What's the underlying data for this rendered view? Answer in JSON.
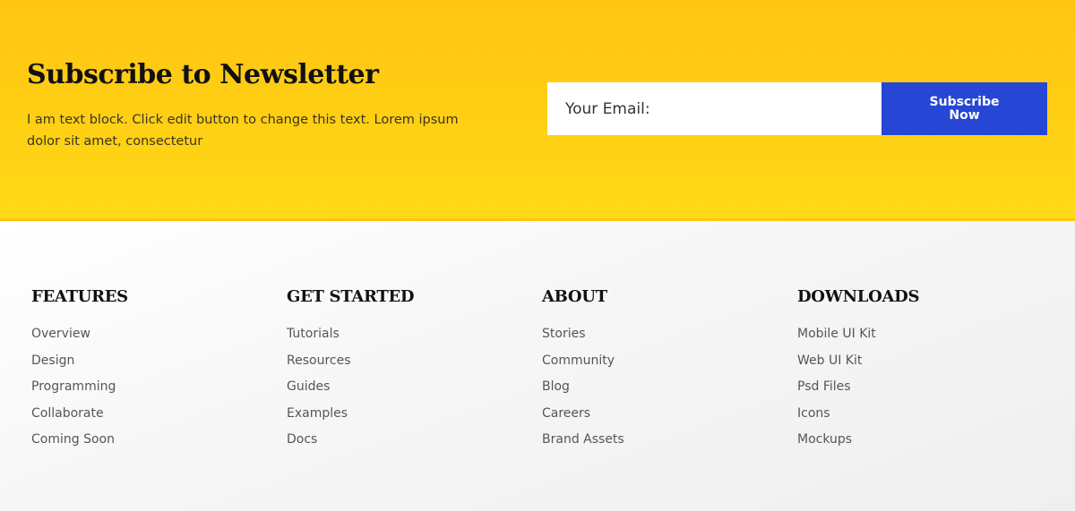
{
  "newsletter": {
    "title": "Subscribe to Newsletter",
    "text": "I am text block. Click edit button to change this text. Lorem ipsum dolor sit amet, consectetur",
    "email_placeholder": "Your Email:",
    "button_label": "Subscribe Now"
  },
  "footer": {
    "columns": [
      {
        "title": "FEATURES",
        "links": [
          "Overview",
          "Design",
          "Programming",
          "Collaborate",
          "Coming Soon"
        ]
      },
      {
        "title": "GET STARTED",
        "links": [
          "Tutorials",
          "Resources",
          "Guides",
          "Examples",
          "Docs"
        ]
      },
      {
        "title": "ABOUT",
        "links": [
          "Stories",
          "Community",
          "Blog",
          "Careers",
          "Brand Assets"
        ]
      },
      {
        "title": "DOWNLOADS",
        "links": [
          "Mobile UI Kit",
          "Web UI Kit",
          "Psd Files",
          "Icons",
          "Mockups"
        ]
      }
    ]
  },
  "colors": {
    "newsletter_background": "#ffc512",
    "button_background": "#2646d6",
    "footer_background": "#f7f7f7"
  }
}
